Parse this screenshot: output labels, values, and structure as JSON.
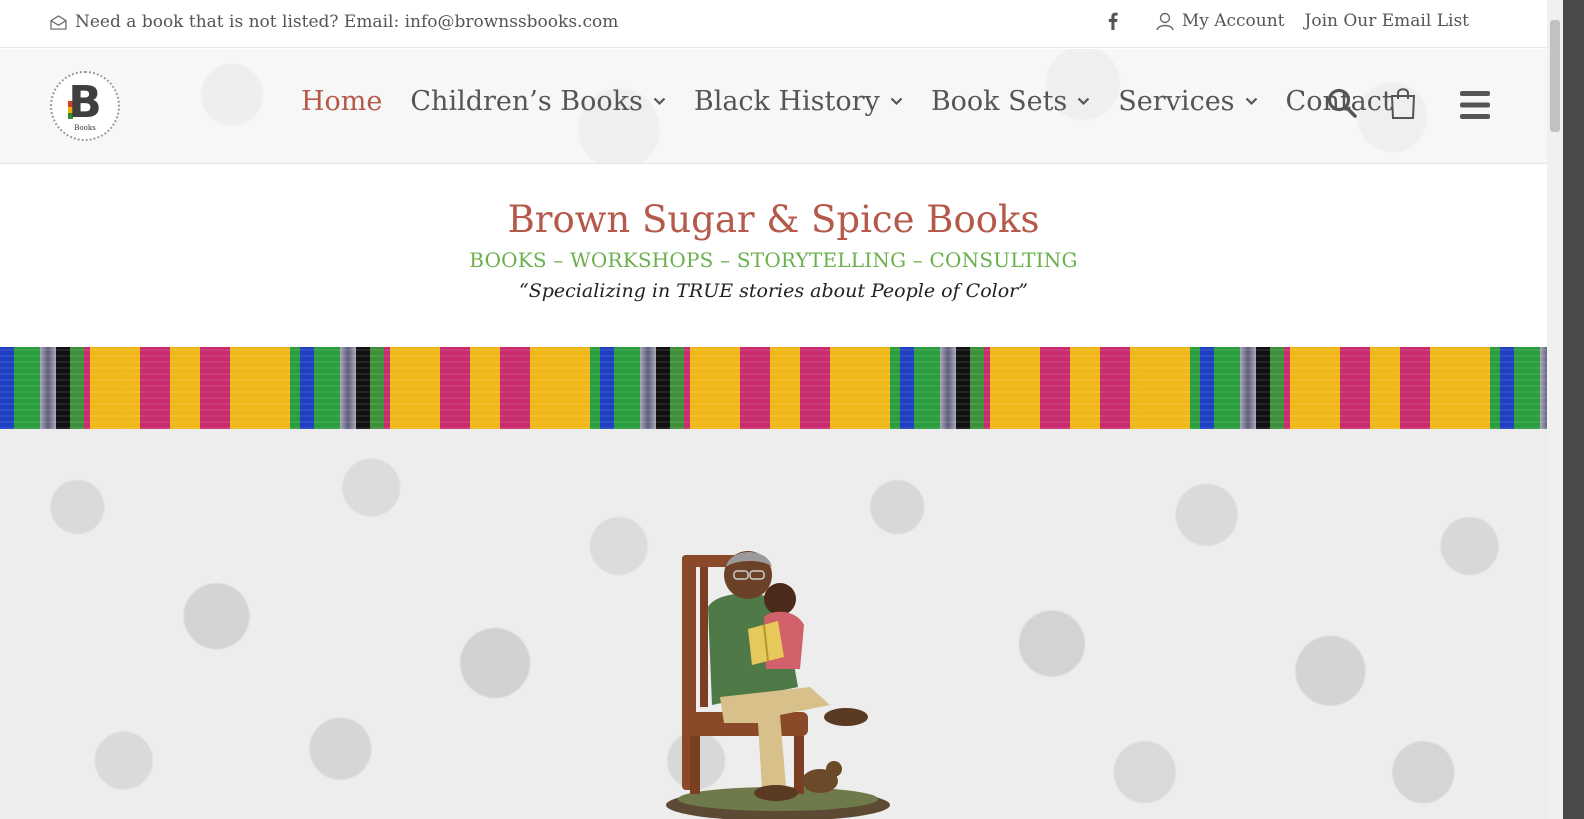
{
  "topbar": {
    "contact_text": "Need a book that is not listed? Email: info@brownssbooks.com",
    "account_label": "My Account",
    "email_list_label": "Join Our Email List"
  },
  "logo": {
    "letter": "B",
    "sub": "Books"
  },
  "nav": {
    "items": [
      {
        "label": "Home",
        "active": true,
        "dropdown": false
      },
      {
        "label": "Children’s Books",
        "dropdown": true
      },
      {
        "label": "Black History",
        "dropdown": true
      },
      {
        "label": "Book Sets",
        "dropdown": true
      },
      {
        "label": "Services",
        "dropdown": true
      },
      {
        "label": "Contact",
        "dropdown": false
      }
    ]
  },
  "hero": {
    "site_title": "Brown Sugar & Spice Books",
    "tagline": "BOOKS – WORKSHOPS – STORYTELLING – CONSULTING",
    "motto": "“Specializing in TRUE stories about People of Color”"
  },
  "colors": {
    "accent": "#b5594a",
    "tagline_green": "#6ab04c",
    "nav_text": "#555555"
  },
  "icons": [
    "mail-icon",
    "facebook-icon",
    "user-icon",
    "search-icon",
    "shopping-bag-icon",
    "menu-icon",
    "chevron-down-icon"
  ]
}
